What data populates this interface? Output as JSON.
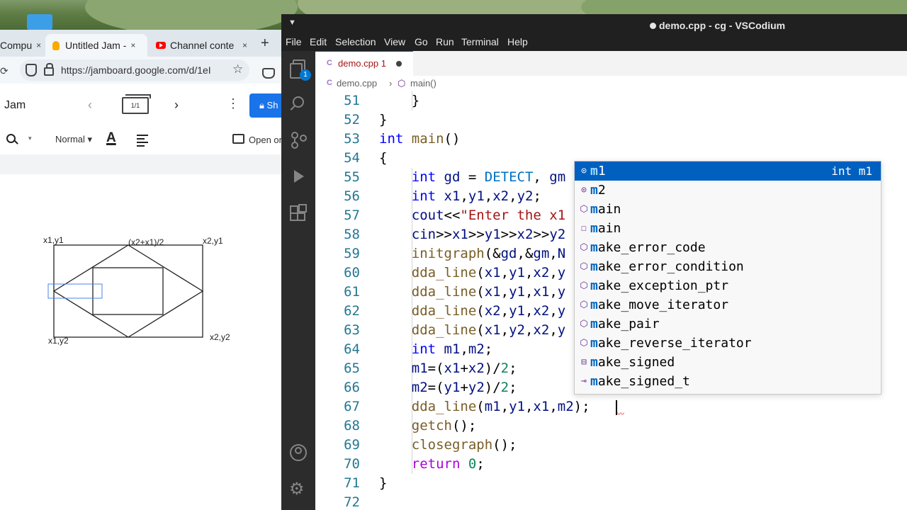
{
  "browser": {
    "tabs": [
      {
        "label": "Compu",
        "icon": "unknown-favicon"
      },
      {
        "label": "Untitled Jam -",
        "icon": "jamboard-icon",
        "active": true
      },
      {
        "label": "Channel conte",
        "icon": "youtube-icon"
      }
    ],
    "tab_close": "×",
    "new_tab": "+",
    "url": "https://jamboard.google.com/d/1eI",
    "url_highlight": "google.com",
    "jam": {
      "title": "Jam",
      "frame_counter": "1/1",
      "share_label": "Sh",
      "zoom_caret": "▾",
      "text_style": "Normal ▾",
      "text_color_glyph": "A",
      "open_on_label": "Open or"
    },
    "drawing_labels": {
      "top_left": "x1,y1",
      "top_mid": "(x2+x1)/2",
      "top_right": "x2,y1",
      "bottom_left": "x1,y2",
      "bottom_right": "x2,y2"
    }
  },
  "vscode": {
    "window_title": "demo.cpp - cg - VSCodium",
    "menu": [
      "File",
      "Edit",
      "Selection",
      "View",
      "Go",
      "Run",
      "Terminal",
      "Help"
    ],
    "explorer_badge": "1",
    "tab": {
      "file": "demo.cpp",
      "problems": "1",
      "language_glyph": "C"
    },
    "breadcrumb": {
      "file": "demo.cpp",
      "separator": "›",
      "symbol": "main()"
    },
    "code_lines": [
      {
        "n": "51",
        "text": "    }"
      },
      {
        "n": "52",
        "text": "}"
      },
      {
        "n": "53",
        "text": "int main()"
      },
      {
        "n": "54",
        "text": "{"
      },
      {
        "n": "55",
        "text": "    int gd = DETECT, gm"
      },
      {
        "n": "56",
        "text": "    int x1,y1,x2,y2;"
      },
      {
        "n": "57",
        "text": "    cout<<\"Enter the x1"
      },
      {
        "n": "58",
        "text": "    cin>>x1>>y1>>x2>>y2"
      },
      {
        "n": "59",
        "text": "    initgraph(&gd,&gm,N"
      },
      {
        "n": "60",
        "text": "    dda_line(x1,y1,x2,y"
      },
      {
        "n": "61",
        "text": "    dda_line(x1,y1,x1,y"
      },
      {
        "n": "62",
        "text": "    dda_line(x2,y1,x2,y"
      },
      {
        "n": "63",
        "text": "    dda_line(x1,y2,x2,y"
      },
      {
        "n": "64",
        "text": "    int m1,m2;"
      },
      {
        "n": "65",
        "text": "    m1=(x1+x2)/2;"
      },
      {
        "n": "66",
        "text": "    m2=(y1+y2)/2;"
      },
      {
        "n": "67",
        "text": "    dda_line(m1,y1,x1,m2);"
      },
      {
        "n": "68",
        "text": "    getch();"
      },
      {
        "n": "69",
        "text": "    closegraph();"
      },
      {
        "n": "70",
        "text": "    return 0;"
      },
      {
        "n": "71",
        "text": "}"
      },
      {
        "n": "72",
        "text": ""
      }
    ],
    "suggestions": [
      {
        "kind": "variable",
        "label": "m1",
        "detail": "int m1",
        "selected": true
      },
      {
        "kind": "variable",
        "label": "m2"
      },
      {
        "kind": "method",
        "label": "main"
      },
      {
        "kind": "text",
        "label": "main"
      },
      {
        "kind": "method",
        "label": "make_error_code"
      },
      {
        "kind": "method",
        "label": "make_error_condition"
      },
      {
        "kind": "method",
        "label": "make_exception_ptr"
      },
      {
        "kind": "method",
        "label": "make_move_iterator"
      },
      {
        "kind": "method",
        "label": "make_pair"
      },
      {
        "kind": "method",
        "label": "make_reverse_iterator"
      },
      {
        "kind": "struct",
        "label": "make_signed"
      },
      {
        "kind": "typedef",
        "label": "make_signed_t"
      }
    ],
    "syntax_colors": {
      "keyword": "#0000ff",
      "function": "#795e26",
      "string": "#a31515",
      "number": "#098658",
      "control": "#af00db",
      "macro": "#0070c1",
      "variable": "#001080"
    }
  }
}
